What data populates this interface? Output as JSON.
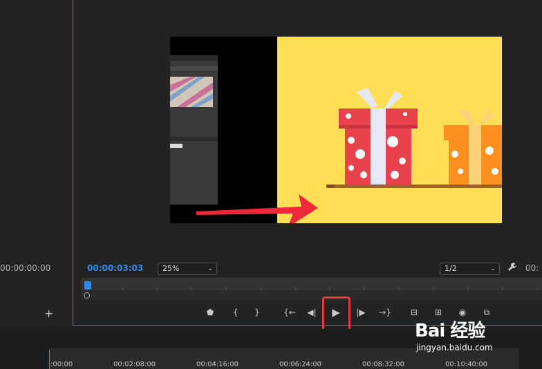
{
  "monitor": {
    "timecode_left": "00:00:00:00",
    "timecode_current": "00:00:03:03",
    "timecode_right": "00:",
    "zoom": "25%",
    "resolution": "1/2"
  },
  "controls": {
    "add_marker": "⬟",
    "mark_in": "{",
    "mark_out": "}",
    "go_to_in": "{←",
    "step_back": "◀|",
    "play": "▶",
    "step_forward": "|▶",
    "go_to_out": "→}",
    "lift": "⊟",
    "extract": "⊞",
    "export_frame": "◉",
    "compare": "⧉"
  },
  "left_panel": {
    "add": "+"
  },
  "timeline": {
    "ticks": [
      ":00:00",
      "00:02:08:00",
      "00:04:16:00",
      "00:06:24:00",
      "00:08:32:00",
      "00:10:40:00"
    ]
  },
  "watermark": {
    "brand": "Bai 经验",
    "url": "jingyan.baidu.com"
  },
  "colors": {
    "accent": "#2d8ceb",
    "highlight": "#e8333c",
    "scene_bg": "#fedf56"
  }
}
